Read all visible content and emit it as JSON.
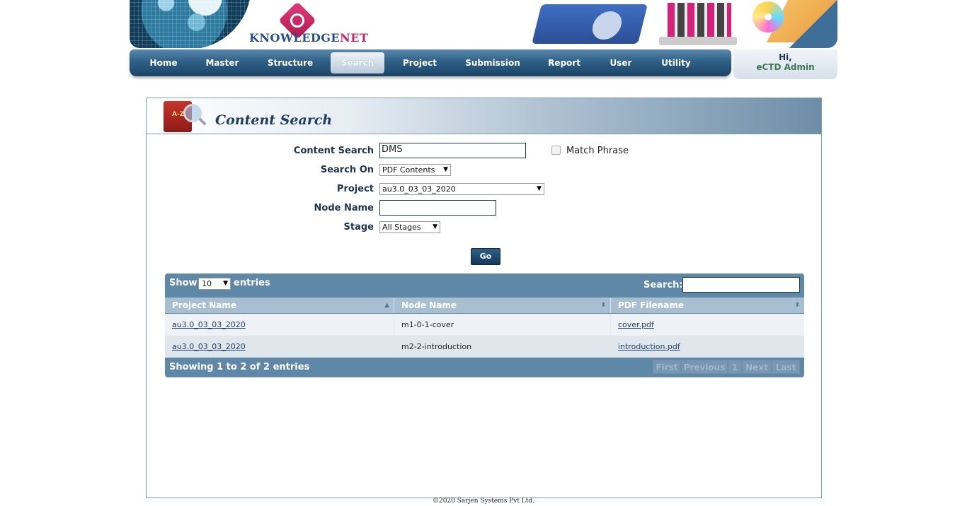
{
  "header": {
    "logo_part1": "KNOWLEDGE",
    "logo_part2": "NET",
    "greeting": "Hi,",
    "user_name": "eCTD Admin"
  },
  "nav": {
    "items": [
      {
        "label": "Home"
      },
      {
        "label": "Master"
      },
      {
        "label": "Structure"
      },
      {
        "label": "Search",
        "active": true
      },
      {
        "label": "Project"
      },
      {
        "label": "Submission"
      },
      {
        "label": "Report"
      },
      {
        "label": "User"
      },
      {
        "label": "Utility"
      }
    ]
  },
  "panel": {
    "icon_text": "A-Z",
    "title": "Content Search"
  },
  "form": {
    "content_search_label": "Content Search",
    "content_search_value": "DMS",
    "match_phrase_label": "Match Phrase",
    "match_phrase_checked": false,
    "search_on_label": "Search On",
    "search_on_value": "PDF Contents",
    "project_label": "Project",
    "project_value": "au3.0_03_03_2020",
    "node_name_label": "Node Name",
    "node_name_value": "",
    "stage_label": "Stage",
    "stage_value": "All Stages",
    "go_label": "Go"
  },
  "table": {
    "show_label": "Show",
    "page_length": "10",
    "entries_label": "entries",
    "search_label": "Search:",
    "search_value": "",
    "columns": [
      "Project Name",
      "Node Name",
      "PDF Filename"
    ],
    "rows": [
      {
        "project": "au3.0_03_03_2020",
        "node": "m1-0-1-cover",
        "pdf": "cover.pdf"
      },
      {
        "project": "au3.0_03_03_2020",
        "node": "m2-2-introduction",
        "pdf": "introduction.pdf"
      }
    ],
    "info": "Showing 1 to 2 of 2 entries",
    "pager": {
      "first": "First",
      "previous": "Previous",
      "page": "1",
      "next": "Next",
      "last": "Last"
    }
  },
  "footer": {
    "copyright": "©2020 Sarjen Systems Pvt Ltd."
  }
}
